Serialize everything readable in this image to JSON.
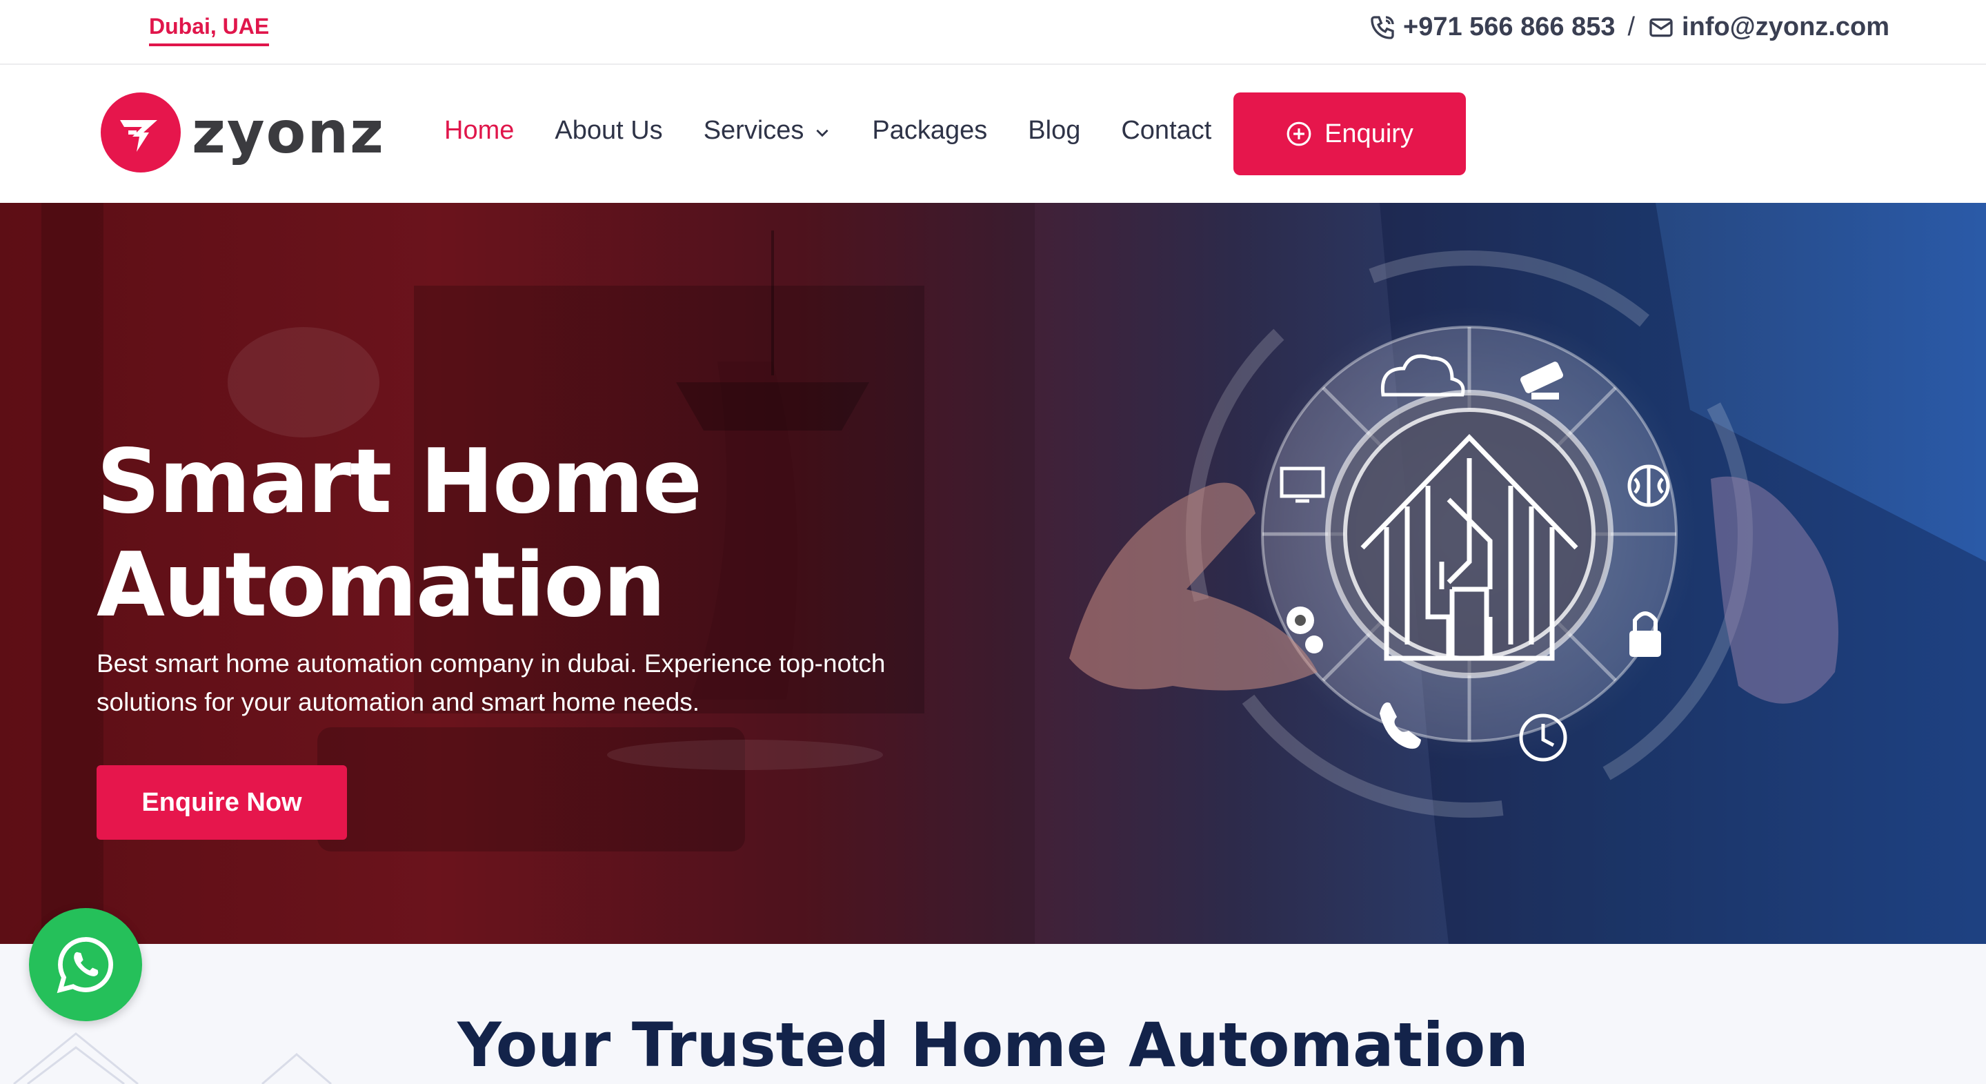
{
  "topbar": {
    "location": "Dubai, UAE",
    "phone": "+971 566 866 853",
    "separator": "/",
    "email": "info@zyonz.com"
  },
  "header": {
    "logo_text": "zyonz",
    "nav": [
      {
        "label": "Home",
        "active": true
      },
      {
        "label": "About Us"
      },
      {
        "label": "Services",
        "has_dropdown": true
      },
      {
        "label": "Packages"
      },
      {
        "label": "Blog"
      },
      {
        "label": "Contact"
      }
    ],
    "enquiry_label": "Enquiry"
  },
  "hero": {
    "title_line1": "Smart Home",
    "title_line2": "Automation",
    "subtitle_line1": "Best smart home automation company in dubai. Experience top-notch",
    "subtitle_line2": "solutions for your automation and smart home needs.",
    "cta_label": "Enquire Now",
    "graphic_icons": [
      "cloud-icon",
      "cctv-camera-icon",
      "monitor-icon",
      "brain-icon",
      "gears-icon",
      "lock-icon",
      "phone-icon",
      "clock-icon",
      "circuit-house-icon"
    ]
  },
  "section": {
    "title": "Your Trusted Home Automation"
  },
  "colors": {
    "accent": "#e6164c",
    "navy": "#13234a",
    "whatsapp": "#25c05a"
  }
}
